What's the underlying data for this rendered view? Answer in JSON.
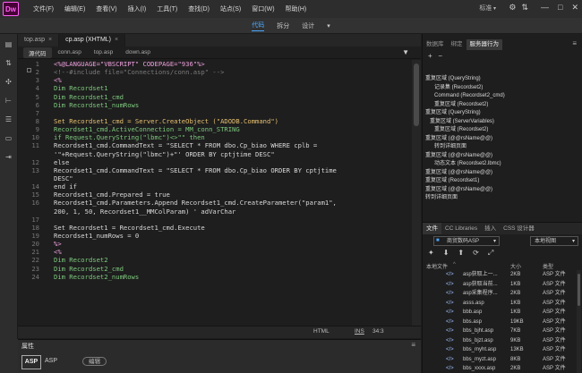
{
  "app": {
    "logo": "Dw"
  },
  "menu": [
    "文件(F)",
    "编辑(E)",
    "查看(V)",
    "插入(I)",
    "工具(T)",
    "查找(D)",
    "站点(S)",
    "窗口(W)",
    "帮助(H)"
  ],
  "workspace": "标准",
  "top_icons": [
    "gear-icon",
    "sync-icon"
  ],
  "window_controls": [
    "—",
    "□",
    "✕"
  ],
  "views": {
    "code": "代码",
    "split": "拆分",
    "design": "设计"
  },
  "doc_tabs": [
    {
      "label": "top.asp"
    },
    {
      "label": "cp.asp (XHTML)"
    }
  ],
  "related_files": {
    "source": "源代码",
    "files": [
      "conn.asp",
      "top.asp",
      "down.asp"
    ]
  },
  "code_lines": [
    {
      "n": "1",
      "t": "<%@LANGUAGE=\"VBSCRIPT\" CODEPAGE=\"936\"%>",
      "c": "#f0a0e0"
    },
    {
      "n": "2",
      "t": "<!--#include file=\"Connections/conn.asp\" -->",
      "c": "#7a7a7a"
    },
    {
      "n": "3",
      "t": "<%",
      "c": "#f0a0e0"
    },
    {
      "n": "4",
      "t": "Dim Recordset1",
      "c": "#7ec97e"
    },
    {
      "n": "5",
      "t": "Dim Recordset1_cmd",
      "c": "#7ec97e"
    },
    {
      "n": "6",
      "t": "Dim Recordset1_numRows",
      "c": "#7ec97e"
    },
    {
      "n": "7",
      "t": "",
      "c": "#c8c8c8"
    },
    {
      "n": "8",
      "t": "Set Recordset1_cmd = Server.CreateObject (\"ADODB.Command\")",
      "c": "#e8c070"
    },
    {
      "n": "9",
      "t": "Recordset1_cmd.ActiveConnection = MM_conn_STRING",
      "c": "#7ec97e"
    },
    {
      "n": "10",
      "t": "if Request.QueryString(\"lbmc\")<>\"\" then",
      "c": "#7ec97e"
    },
    {
      "n": "11",
      "t": "Recordset1_cmd.CommandText = \"SELECT * FROM dbo.Cp_biao WHERE cplb =",
      "c": "#d8d8d8"
    },
    {
      "n": "",
      "t": "'\"+Request.QueryString(\"lbmc\")+\"' ORDER BY cptjtime DESC\"",
      "c": "#d8d8d8"
    },
    {
      "n": "12",
      "t": "else",
      "c": "#d8d8d8"
    },
    {
      "n": "13",
      "t": "Recordset1_cmd.CommandText = \"SELECT * FROM dbo.Cp_biao ORDER BY cptjtime",
      "c": "#d8d8d8"
    },
    {
      "n": "",
      "t": "DESC\"",
      "c": "#d8d8d8"
    },
    {
      "n": "14",
      "t": "end if",
      "c": "#d8d8d8"
    },
    {
      "n": "15",
      "t": "Recordset1_cmd.Prepared = true",
      "c": "#d8d8d8"
    },
    {
      "n": "16",
      "t": "Recordset1_cmd.Parameters.Append Recordset1_cmd.CreateParameter(\"param1\",",
      "c": "#d8d8d8"
    },
    {
      "n": "",
      "t": "200, 1, 50, Recordset1__MMColParam) ' adVarChar",
      "c": "#d8d8d8"
    },
    {
      "n": "17",
      "t": "",
      "c": "#d8d8d8"
    },
    {
      "n": "18",
      "t": "Set Recordset1 = Recordset1_cmd.Execute",
      "c": "#d8d8d8"
    },
    {
      "n": "19",
      "t": "Recordset1_numRows = 0",
      "c": "#d8d8d8"
    },
    {
      "n": "20",
      "t": "%>",
      "c": "#f0a0e0"
    },
    {
      "n": "21",
      "t": "<%",
      "c": "#f0a0e0"
    },
    {
      "n": "22",
      "t": "Dim Recordset2",
      "c": "#7ec97e"
    },
    {
      "n": "23",
      "t": "Dim Recordset2_cmd",
      "c": "#7ec97e"
    },
    {
      "n": "24",
      "t": "Dim Recordset2_numRows",
      "c": "#7ec97e"
    }
  ],
  "status": {
    "lang": "HTML",
    "mode": "INS",
    "pos": "34:3"
  },
  "properties": {
    "title": "属性",
    "badge": "ASP",
    "label": "ASP",
    "edit": "编辑"
  },
  "right_tabs": {
    "db": "数据库",
    "bind": "绑定",
    "behaviors": "服务器行为"
  },
  "behaviors": [
    {
      "t": "重复区域 (QueryString)",
      "i": 0
    },
    {
      "t": "记录集 (Recordset2)",
      "i": 2
    },
    {
      "t": "Command (Recordset2_cmd)",
      "i": 2
    },
    {
      "t": "重复区域 (Recordset2)",
      "i": 2
    },
    {
      "t": "重复区域 (QueryString)",
      "i": 0
    },
    {
      "t": "重复区域 (ServerVariables)",
      "i": 1
    },
    {
      "t": "重复区域 (Recordset2)",
      "i": 2
    },
    {
      "t": "重复区域 (@@rsName@@)",
      "i": 0
    },
    {
      "t": "转到详细页面",
      "i": 2
    },
    {
      "t": "重复区域 (@@rsName@@)",
      "i": 0
    },
    {
      "t": "动态文本 (Recordset2.lbmc)",
      "i": 2
    },
    {
      "t": "重复区域 (@@rsName@@)",
      "i": 0
    },
    {
      "t": "重复区域 (Recordset1)",
      "i": 0
    },
    {
      "t": "重复区域 (@@rsName@@)",
      "i": 0
    },
    {
      "t": "转到详细页面",
      "i": 0
    }
  ],
  "file_tabs": {
    "files": "文件",
    "cc": "CC Libraries",
    "insert": "插入",
    "css": "CSS 设计器"
  },
  "site": "商贸数码ASP",
  "site_view": "本地视图",
  "file_header": {
    "name": "本地文件",
    "size": "大小",
    "type": "类型"
  },
  "files": [
    {
      "name": "asp获取上一...",
      "size": "2KB",
      "type": "ASP 文件"
    },
    {
      "name": "asp获取当前...",
      "size": "1KB",
      "type": "ASP 文件"
    },
    {
      "name": "asp采集程序...",
      "size": "2KB",
      "type": "ASP 文件"
    },
    {
      "name": "asss.asp",
      "size": "1KB",
      "type": "ASP 文件"
    },
    {
      "name": "bbb.asp",
      "size": "1KB",
      "type": "ASP 文件"
    },
    {
      "name": "bbs.asp",
      "size": "19KB",
      "type": "ASP 文件"
    },
    {
      "name": "bbs_bjht.asp",
      "size": "7KB",
      "type": "ASP 文件"
    },
    {
      "name": "bbs_bjzt.asp",
      "size": "9KB",
      "type": "ASP 文件"
    },
    {
      "name": "bbs_myht.asp",
      "size": "13KB",
      "type": "ASP 文件"
    },
    {
      "name": "bbs_myzt.asp",
      "size": "8KB",
      "type": "ASP 文件"
    },
    {
      "name": "bbs_xxxx.asp",
      "size": "2KB",
      "type": "ASP 文件"
    }
  ]
}
